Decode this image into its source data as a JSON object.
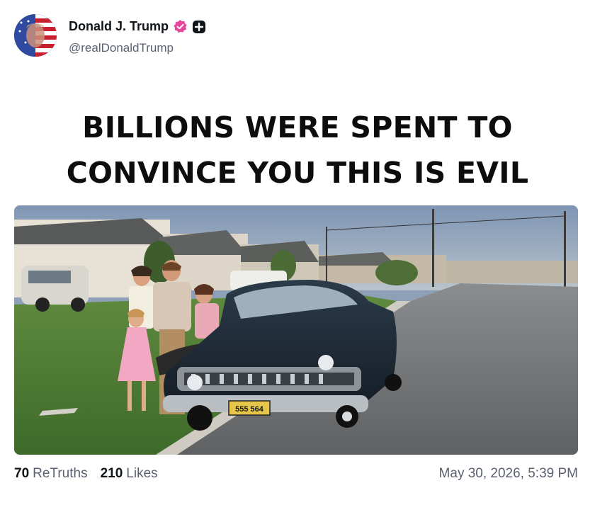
{
  "author": {
    "display_name": "Donald J. Trump",
    "handle": "@realDonaldTrump",
    "avatar_icon": "flag-portrait-avatar",
    "verified_icon": "verified-badge-icon",
    "badge_icon": "plus-badge-icon",
    "verified_color": "#e8449b"
  },
  "post": {
    "text_line_1": "BILLIONS WERE SPENT TO",
    "text_line_2": "CONVINCE YOU THIS IS EVIL",
    "image": {
      "subject": "family-with-vintage-car-photo",
      "license_plate": "555 564"
    }
  },
  "stats": {
    "retruths_count": "70",
    "retruths_label": "ReTruths",
    "likes_count": "210",
    "likes_label": "Likes"
  },
  "timestamp": "May 30, 2026, 5:39 PM"
}
